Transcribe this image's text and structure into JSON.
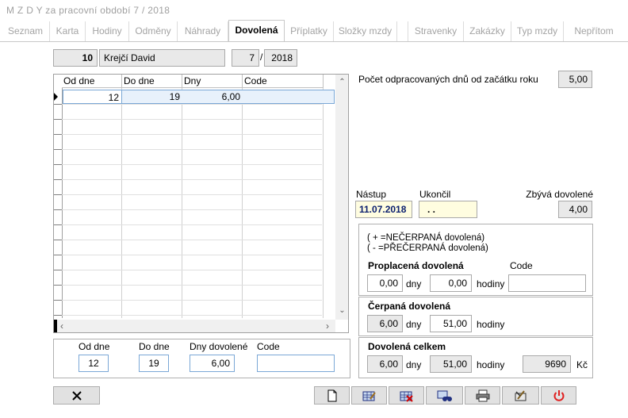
{
  "title": "M Z D Y  za pracovní období  7 / 2018",
  "tabs": [
    "Seznam",
    "Karta",
    "Hodiny",
    "Odměny",
    "Náhrady",
    "Dovolená",
    "Příplatky",
    "Složky mzdy",
    "Stravenky",
    "Zakázky",
    "Typ mzdy",
    "Nepřítom"
  ],
  "header": {
    "emp_id": "10",
    "emp_name": "Krejčí David",
    "month": "7",
    "sep": "/",
    "year": "2018"
  },
  "grid": {
    "columns": [
      "Od dne",
      "Do dne",
      "Dny dovolené",
      "Code"
    ],
    "rows": [
      {
        "od": "12",
        "do": "19",
        "dny": "6,00",
        "code": ""
      }
    ]
  },
  "right": {
    "worked_label": "Počet  odpracovaných dnů od začátku roku",
    "worked_value": "5,00",
    "nastup_label": "Nástup",
    "nastup_value": "11.07.2018",
    "ukoncil_label": "Ukončil",
    "ukoncil_value": ". .",
    "zbyva_label": "Zbývá dovolené",
    "zbyva_value": "4,00",
    "legend1": "( + =NEČERPANÁ dovolená)",
    "legend2": "( -  =PŘEČERPANÁ dovolená)",
    "proplacena_label": "Proplacená dovolená",
    "code_label": "Code",
    "proplacena_dny": "0,00",
    "proplacena_hod": "0,00",
    "cerpana_label": "Čerpaná dovolená",
    "cerpana_dny": "6,00",
    "cerpana_hod": "51,00",
    "celkem_label": "Dovolená celkem",
    "celkem_dny": "6,00",
    "celkem_hod": "51,00",
    "celkem_kc": "9690",
    "dny": "dny",
    "hodiny": "hodiny",
    "kc": "Kč"
  },
  "edit": {
    "od_label": "Od dne",
    "do_label": "Do dne",
    "dny_label": "Dny dovolené",
    "code_label": "Code",
    "od": "12",
    "do": "19",
    "dny": "6,00",
    "code": ""
  }
}
